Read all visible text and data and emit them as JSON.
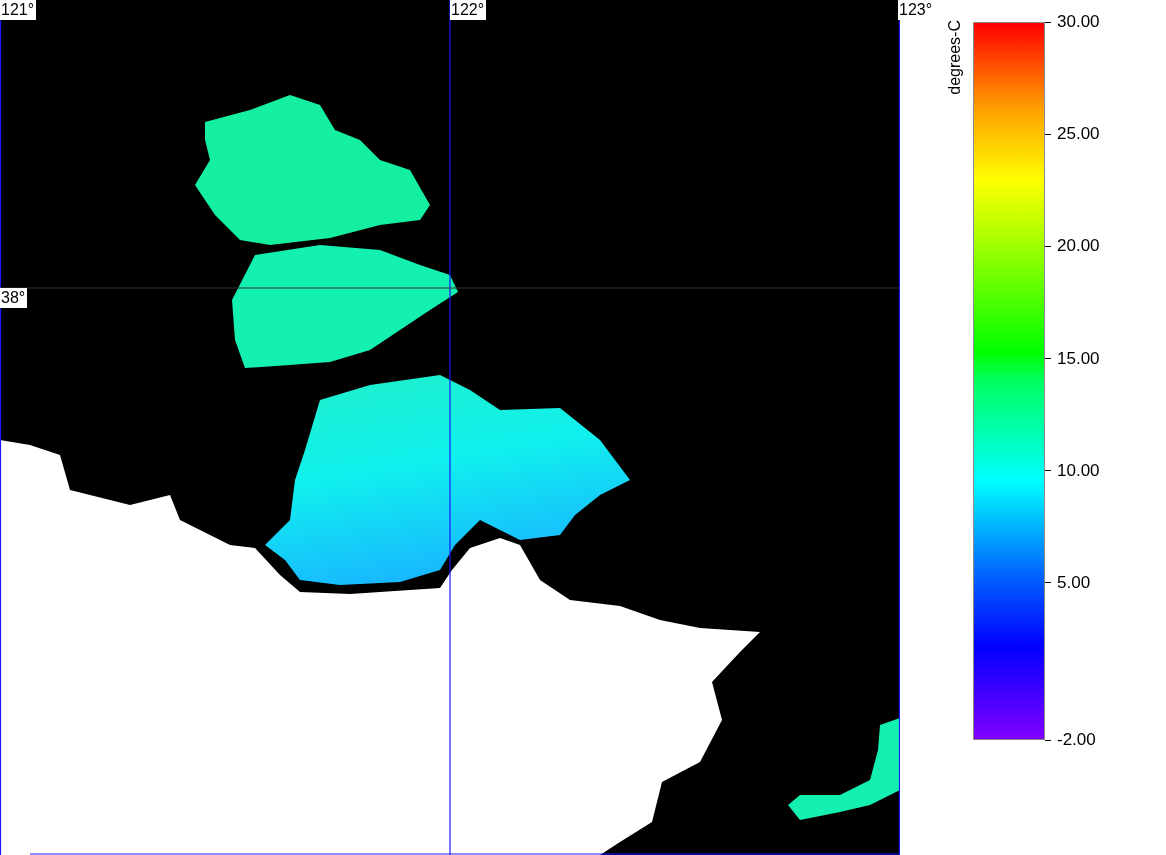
{
  "map": {
    "longitude_labels": [
      "121°",
      "122°",
      "123°"
    ],
    "latitude_labels": [
      "38°"
    ]
  },
  "colorbar": {
    "title": "degrees-C",
    "ticks": [
      "30.00",
      "25.00",
      "20.00",
      "15.00",
      "10.00",
      "5.00",
      "-2.00"
    ]
  }
}
